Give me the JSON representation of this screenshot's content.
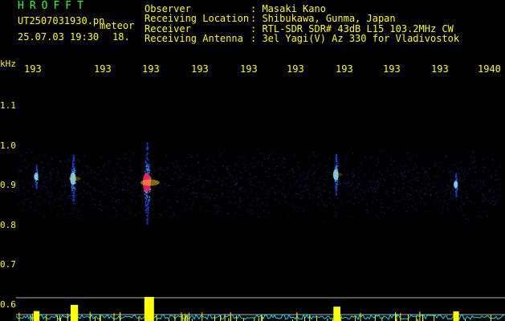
{
  "station": {
    "brand": "HROFFT",
    "file_name": "UT2507031930.pn",
    "meteor_word": "meteor",
    "date_time": "25.07.03 19:30",
    "count": "18."
  },
  "info": {
    "labels": [
      "Observer",
      "Receiving Location",
      "Receiver",
      "Receiving Antenna"
    ],
    "values": [
      ": Masaki Kano",
      ": Shibukawa, Gunma, Japan",
      ": RTL-SDR SDR# 43dB L15 103.2MHz CW",
      ": 3el Yagi(V) Az 330 for Vladivostok"
    ]
  },
  "axis": {
    "unit": "kHz",
    "y_ticks": [
      "1.1",
      "1.0",
      "0.9",
      "0.8",
      "0.7",
      "0.6"
    ],
    "time_ticks": [
      "193",
      "193",
      "193",
      "193",
      "193",
      "193",
      "193",
      "193",
      "193",
      "1940"
    ]
  },
  "colors": {
    "text": "#ffff00",
    "brand": "#33ff33",
    "background": "#000000",
    "noise": "#1a3bd6",
    "echo_core": "#ff1a6a",
    "baseline": "#00e5ff"
  },
  "echoes": [
    {
      "time_min": 1930.7,
      "freq_khz": 0.915,
      "strength": 0.55
    },
    {
      "time_min": 1932.3,
      "freq_khz": 0.905,
      "strength": 1.0
    },
    {
      "time_min": 1936.4,
      "freq_khz": 0.925,
      "strength": 0.45
    },
    {
      "time_min": 1929.9,
      "freq_khz": 0.92,
      "strength": 0.2
    },
    {
      "time_min": 1939.0,
      "freq_khz": 0.9,
      "strength": 0.18
    }
  ]
}
